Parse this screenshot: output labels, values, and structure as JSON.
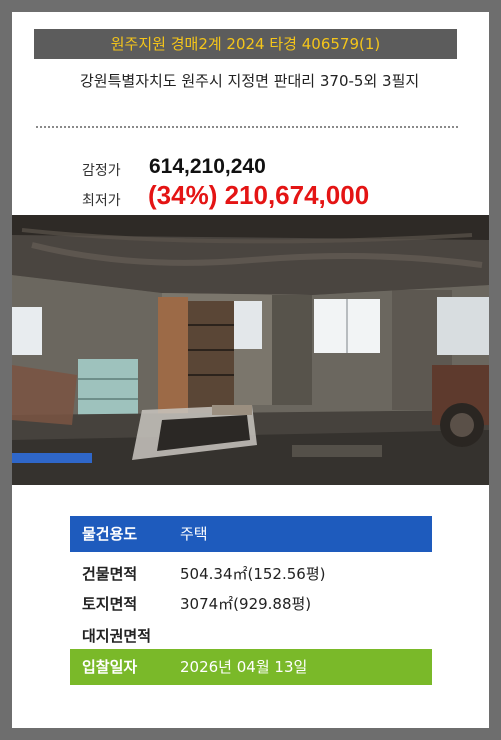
{
  "header": {
    "case_title": "원주지원 경매2계 2024 타경 406579(1)",
    "address": "강원특별자치도 원주시 지정면 판대리 370-5외 3필지"
  },
  "prices": {
    "appraisal_label": "감정가",
    "appraisal_value": "614,210,240",
    "minimum_label": "최저가",
    "minimum_value": "(34%) 210,674,000"
  },
  "property": {
    "usage_label": "물건용도",
    "usage_value": "주택",
    "building_area_label": "건물면적",
    "building_area_value": "504.34㎡(152.56평)",
    "land_area_label": "토지면적",
    "land_area_value": "3074㎡(929.88평)",
    "land_rights_label": "대지권면적",
    "bid_date_label": "입찰일자",
    "bid_date_value": "2026년 04월 13일"
  },
  "colors": {
    "banner_text": "#f4c51a",
    "minimum_price": "#e41414",
    "usage_bar": "#1e5bbd",
    "bid_bar": "#7ab929"
  }
}
